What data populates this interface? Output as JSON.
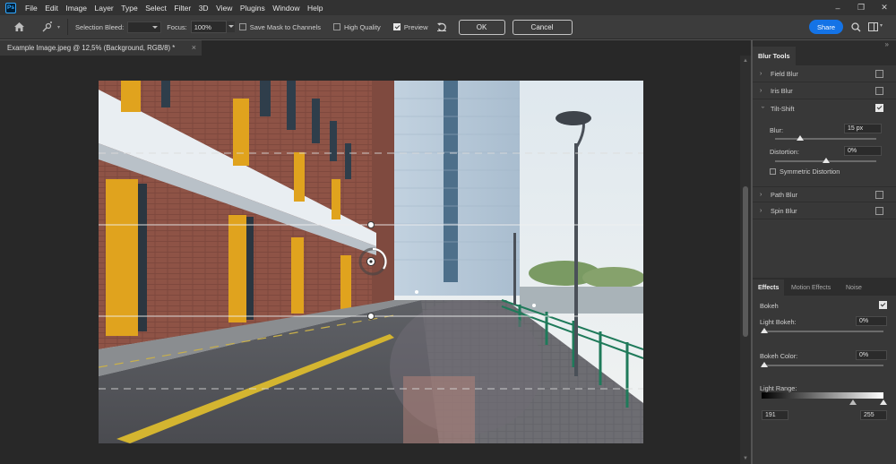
{
  "app": {
    "logo": "Ps"
  },
  "menu": [
    "File",
    "Edit",
    "Image",
    "Layer",
    "Type",
    "Select",
    "Filter",
    "3D",
    "View",
    "Plugins",
    "Window",
    "Help"
  ],
  "window_controls": {
    "minimize": "–",
    "restore": "❐",
    "close": "✕"
  },
  "options": {
    "selection_bleed_label": "Selection Bleed:",
    "focus_label": "Focus:",
    "focus_value": "100%",
    "save_mask_label": "Save Mask to Channels",
    "save_mask_checked": false,
    "high_quality_label": "High Quality",
    "high_quality_checked": false,
    "preview_label": "Preview",
    "preview_checked": true,
    "ok_label": "OK",
    "cancel_label": "Cancel",
    "share_label": "Share"
  },
  "document": {
    "tab_title": "Example Image.jpeg @ 12,5% (Background, RGB/8) *",
    "close": "×"
  },
  "panel": {
    "title": "Blur Tools",
    "collapse": "»",
    "blurs": [
      {
        "label": "Field Blur",
        "checked": false,
        "expanded": false
      },
      {
        "label": "Iris Blur",
        "checked": false,
        "expanded": false
      },
      {
        "label": "Tilt-Shift",
        "checked": true,
        "expanded": true
      },
      {
        "label": "Path Blur",
        "checked": false,
        "expanded": false
      },
      {
        "label": "Spin Blur",
        "checked": false,
        "expanded": false
      }
    ],
    "tilt_shift": {
      "blur_label": "Blur:",
      "blur_value": "15 px",
      "blur_level": 0.25,
      "distortion_label": "Distortion:",
      "distortion_value": "0%",
      "distortion_level": 0.5,
      "symmetric_label": "Symmetric Distortion",
      "symmetric_checked": false
    },
    "effects_tabs": [
      "Effects",
      "Motion Effects",
      "Noise"
    ],
    "effects": {
      "bokeh_label": "Bokeh",
      "bokeh_checked": true,
      "light_bokeh_label": "Light Bokeh:",
      "light_bokeh_value": "0%",
      "bokeh_color_label": "Bokeh Color:",
      "bokeh_color_value": "0%",
      "light_range_label": "Light Range:",
      "light_range_min": "191",
      "light_range_max": "255"
    }
  },
  "icons": [
    "home-icon",
    "tilt-shift-tool-icon",
    "reset-icon",
    "search-icon",
    "workspace-icon",
    "panel-expand-icon"
  ],
  "colors": {
    "accent": "#1473e6",
    "panel_bg": "#383838",
    "workspace_bg": "#282828"
  }
}
